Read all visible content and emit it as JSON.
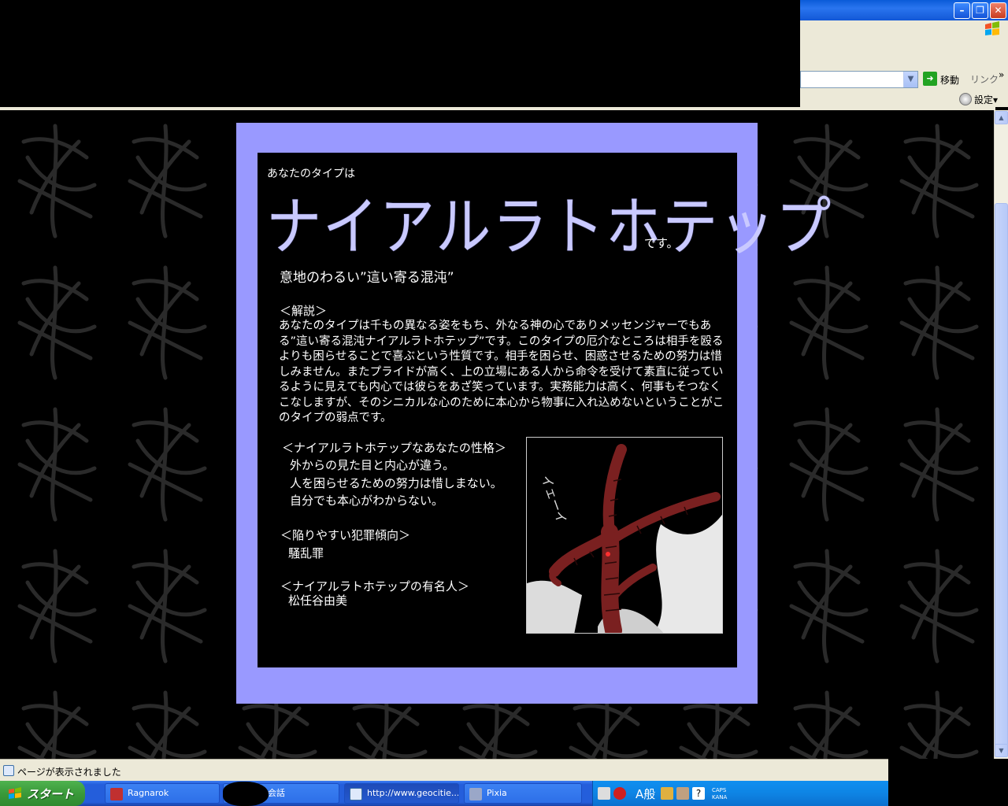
{
  "browser": {
    "go_label": "移動",
    "links_label": "リンク",
    "links_chevron": "»",
    "settings_label": "設定▾",
    "status_text": "ページが表示されました"
  },
  "page": {
    "intro": "あなたのタイプは",
    "type_name": "ナイアルラトホテップ",
    "suffix": "です。",
    "subtitle": "意地のわるい”這い寄る混沌”",
    "desc_head": "＜解説＞",
    "description": "あなたのタイプは千もの異なる姿をもち、外なる神の心でありメッセンジャーでもある”這い寄る混沌ナイアルラトホテップ”です。このタイプの厄介なところは相手を殴るよりも困らせることで喜ぶという性質です。相手を困らせ、困惑させるための努力は惜しみません。またプライドが高く、上の立場にある人から命令を受けて素直に従っているように見えても内心では彼らをあざ笑っています。実務能力は高く、何事もそつなくこなしますが、そのシニカルな心のために本心から物事に入れ込めないということがこのタイプの弱点です。",
    "personality_head": "＜ナイアルラトホテップなあなたの性格＞",
    "personality": [
      "外からの見た目と内心が違う。",
      "人を困らせるための努力は惜しまない。",
      "自分でも本心がわからない。"
    ],
    "crime_head": "＜陥りやすい犯罪傾向＞",
    "crime": "騒乱罪",
    "famous_head": "＜ナイアルラトホテップの有名人＞",
    "famous": "松任谷由美",
    "illustration_text": "イェーイ"
  },
  "taskbar": {
    "start_label": "スタート",
    "tasks": [
      {
        "label": "Ragnarok"
      },
      {
        "label": "会話"
      },
      {
        "label": "http://www.geocitie..."
      },
      {
        "label": "Pixia"
      }
    ],
    "ime_label": "A般",
    "caps_label": "CAPS",
    "kana_label": "KANA"
  },
  "colors": {
    "card_border": "#9999ff",
    "title_color": "#c9c9ff"
  }
}
